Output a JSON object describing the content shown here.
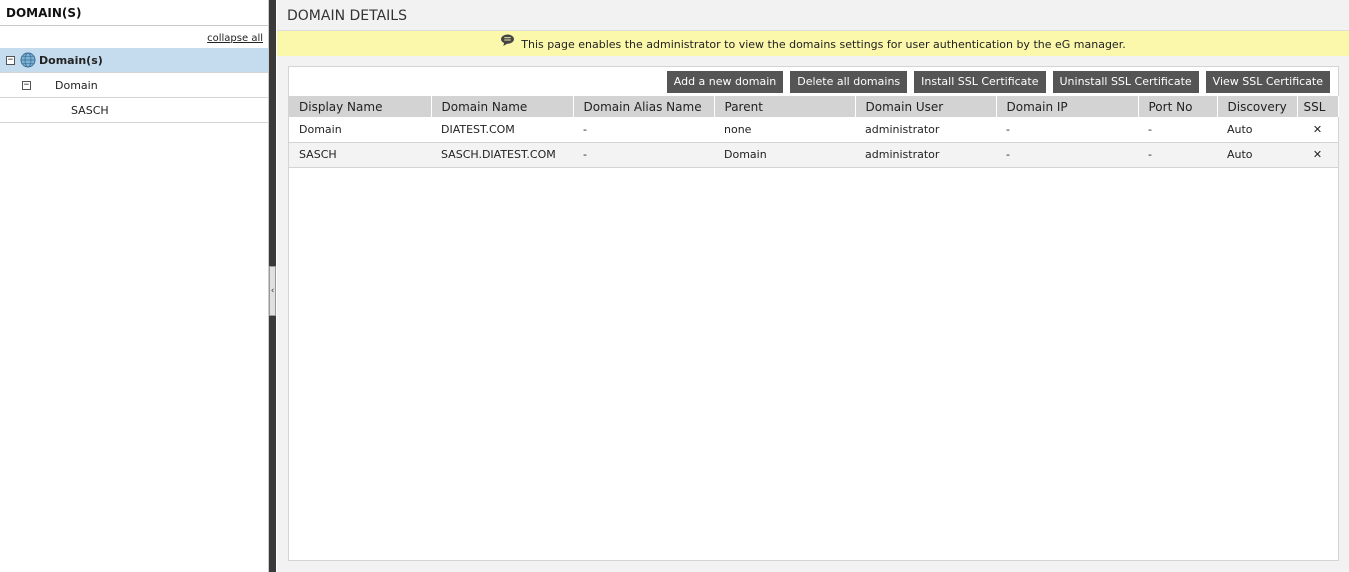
{
  "left": {
    "header": "DOMAIN(S)",
    "collapse_all": "collapse all",
    "tree": {
      "root": {
        "label": "Domain(s)",
        "toggle": "−"
      },
      "child": {
        "label": "Domain",
        "toggle": "−"
      },
      "leaf": {
        "label": "SASCH"
      }
    }
  },
  "splitter": {
    "arrow": "‹"
  },
  "main": {
    "title": "DOMAIN DETAILS",
    "info": "This page enables the administrator to view the domains settings for user authentication by the eG manager.",
    "buttons": {
      "add": "Add a new domain",
      "delete_all": "Delete all domains",
      "install_ssl": "Install SSL Certificate",
      "uninstall_ssl": "Uninstall SSL Certificate",
      "view_ssl": "View SSL Certificate"
    },
    "columns": [
      "Display Name",
      "Domain Name",
      "Domain Alias Name",
      "Parent",
      "Domain User",
      "Domain IP",
      "Port No",
      "Discovery",
      "SSL"
    ],
    "rows": [
      [
        "Domain",
        "DIATEST.COM",
        "-",
        "none",
        "administrator",
        "-",
        "-",
        "Auto",
        "✕"
      ],
      [
        "SASCH",
        "SASCH.DIATEST.COM",
        "-",
        "Domain",
        "administrator",
        "-",
        "-",
        "Auto",
        "✕"
      ]
    ]
  },
  "colors": {
    "info_bar": "#fbf7ab",
    "button_bg": "#555555",
    "selected_row": "#c5dcef",
    "table_header": "#d3d3d3"
  },
  "icons": {
    "root": "globe-icon",
    "info": "speech-bubble-icon",
    "ssl": "close-x-icon"
  }
}
